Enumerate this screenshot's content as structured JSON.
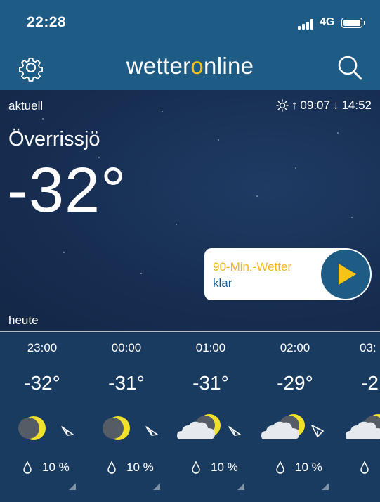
{
  "status_bar": {
    "time": "22:28",
    "network": "4G"
  },
  "app_bar": {
    "logo_prefix": "wetter",
    "logo_o": "o",
    "logo_suffix": "nline"
  },
  "current": {
    "label": "aktuell",
    "sunrise": "09:07",
    "sunset": "14:52",
    "city": "Överrissjö",
    "temperature": "-32°"
  },
  "nowcast": {
    "title": "90-Min.-Wetter",
    "status": "klar"
  },
  "today_label": "heute",
  "hourly": [
    {
      "time": "23:00",
      "temp": "-32°",
      "icon": "moon-clear-icon",
      "precip": "10 %"
    },
    {
      "time": "00:00",
      "temp": "-31°",
      "icon": "moon-clear-icon",
      "precip": "10 %"
    },
    {
      "time": "01:00",
      "temp": "-31°",
      "icon": "moon-cloudy-icon",
      "precip": "10 %"
    },
    {
      "time": "02:00",
      "temp": "-29°",
      "icon": "moon-cloudy-icon",
      "precip": "10 %"
    },
    {
      "time": "03:",
      "temp": "-2",
      "icon": "moon-cloudy-icon",
      "precip": ""
    }
  ],
  "colors": {
    "header": "#1e5c86",
    "accent": "#f4c316",
    "sky": "#172e52",
    "hourly_bg": "#1a3b60"
  }
}
